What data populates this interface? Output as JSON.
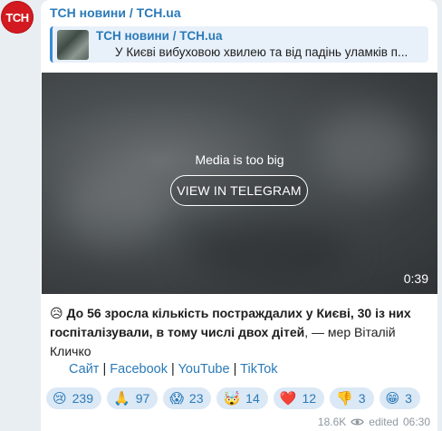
{
  "channel": {
    "avatar_text": "ТСН",
    "name": "ТСН новини / TCH.ua"
  },
  "reply": {
    "title": "ТСН новини / TCH.ua",
    "text": "У Києві вибуховою хвилею та від падінь уламків п..."
  },
  "media": {
    "message": "Media is too big",
    "button": "VIEW IN TELEGRAM",
    "duration": "0:39"
  },
  "post": {
    "emoji": "😥",
    "bold_text": "До 56 зросла кількість постраждалих у Києві, 30 із них госпіталізували, в тому числі двох дітей",
    "tail_text": ", — мер Віталій Кличко"
  },
  "links": {
    "site": "Сайт",
    "sep1": "|",
    "facebook": "Facebook",
    "sep2": "|",
    "youtube": "YouTube",
    "sep3": "|",
    "tiktok": "TikTok"
  },
  "reactions": [
    {
      "emoji": "😢",
      "count": "239"
    },
    {
      "emoji": "🙏",
      "count": "97"
    },
    {
      "emoji": "😱",
      "count": "23"
    },
    {
      "emoji": "🤯",
      "count": "14"
    },
    {
      "emoji": "❤️",
      "count": "12"
    },
    {
      "emoji": "👎",
      "count": "3"
    },
    {
      "emoji": "😁",
      "count": "3"
    }
  ],
  "meta": {
    "views": "18.6K",
    "edited": "edited",
    "time": "06:30"
  },
  "colors": {
    "accent": "#2a7ab8",
    "avatar_bg": "#d21a20",
    "background": "#e9eef2",
    "reaction_bg": "#dbe8f5"
  }
}
